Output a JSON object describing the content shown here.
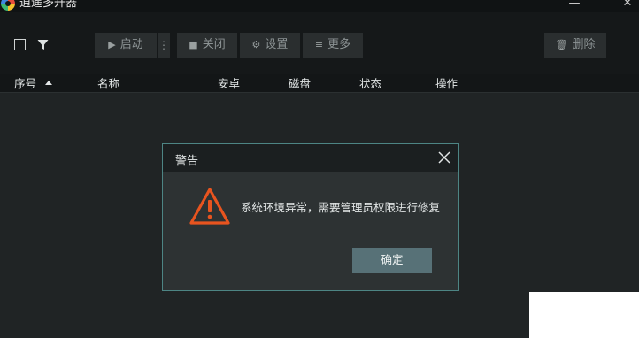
{
  "window": {
    "title": "逍遥多开器",
    "minimize_glyph": "—",
    "close_glyph": "✕"
  },
  "toolbar": {
    "start_label": "启动",
    "start_icon": "play-icon",
    "more_dots": "⋮",
    "close_label": "关闭",
    "close_icon": "stop-icon",
    "settings_label": "设置",
    "settings_icon": "gear-icon",
    "more_label": "更多",
    "more_icon": "menu-icon",
    "delete_label": "删除",
    "delete_icon": "trash-icon"
  },
  "table": {
    "columns": [
      "序号",
      "名称",
      "安卓",
      "磁盘",
      "状态",
      "操作"
    ],
    "rows": []
  },
  "dialog": {
    "title": "警告",
    "message": "系统环境异常，需要管理员权限进行修复",
    "ok_label": "确定",
    "icon": "warning-icon",
    "accent_color": "#e8541f"
  },
  "colors": {
    "background": "#202425",
    "toolbar": "#151819",
    "dialog_border": "#4d8584",
    "ok_button": "#577177"
  }
}
